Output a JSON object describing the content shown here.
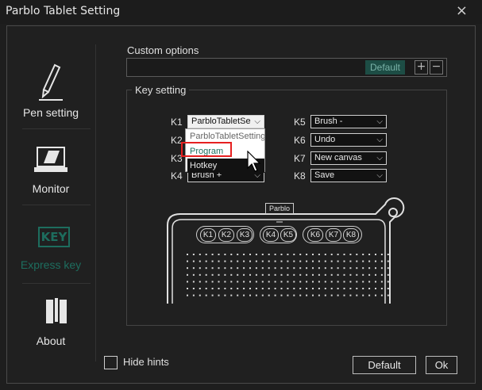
{
  "window": {
    "title": "Parblo Tablet Setting",
    "close": "×"
  },
  "sidebar": {
    "items": [
      {
        "label": "Pen setting"
      },
      {
        "label": "Monitor"
      },
      {
        "label": "Express key",
        "icon_text": "KEY"
      },
      {
        "label": "About"
      }
    ]
  },
  "custom_options": {
    "title": "Custom options",
    "default_tag": "Default",
    "plus": "+",
    "minus": "−"
  },
  "key_setting": {
    "title": "Key setting",
    "keys": [
      {
        "label": "K1",
        "value": "ParbloTabletSe"
      },
      {
        "label": "K2",
        "value": ""
      },
      {
        "label": "K3",
        "value": ""
      },
      {
        "label": "K4",
        "value": "Brush +"
      },
      {
        "label": "K5",
        "value": "Brush -"
      },
      {
        "label": "K6",
        "value": "Undo"
      },
      {
        "label": "K7",
        "value": "New canvas"
      },
      {
        "label": "K8",
        "value": "Save"
      }
    ],
    "dropdown_options": [
      "ParbloTabletSetting",
      "Program",
      "Hotkey"
    ]
  },
  "tablet": {
    "label": "Parblo",
    "keys": [
      "K1",
      "K2",
      "K3",
      "K4",
      "K5",
      "K6",
      "K7",
      "K8"
    ]
  },
  "footer": {
    "hide_hints": "Hide hints",
    "default_button": "Default",
    "ok_button": "Ok"
  },
  "colors": {
    "accent": "#1d6d5e",
    "highlight": "#e62020"
  }
}
